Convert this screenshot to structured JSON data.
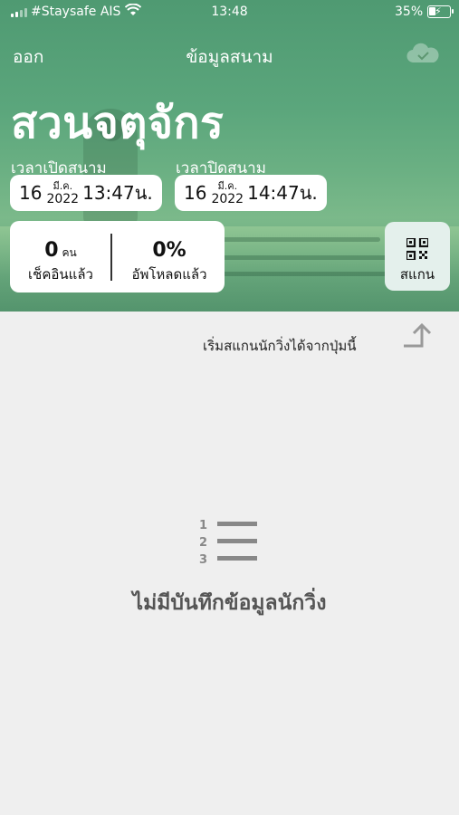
{
  "status_bar": {
    "carrier": "#Staysafe AIS",
    "time": "13:48",
    "battery_percent": "35%",
    "battery_level": 0.35
  },
  "nav": {
    "left_label": "ออก",
    "title": "ข้อมูลสนาม",
    "right_icon": "cloud-check-icon"
  },
  "field": {
    "name": "สวนจตุจักร"
  },
  "open_time": {
    "label": "เวลาเปิดสนาม",
    "day": "16",
    "month": "มี.ค.",
    "year": "2022",
    "time": "13:47น."
  },
  "close_time": {
    "label": "เวลาปิดสนาม",
    "day": "16",
    "month": "มี.ค.",
    "year": "2022",
    "time": "14:47น."
  },
  "stats": {
    "checked_in": {
      "value": "0",
      "unit": "คน",
      "label": "เช็คอินแล้ว"
    },
    "uploaded": {
      "value": "0%",
      "label": "อัพโหลดแล้ว"
    }
  },
  "scan_button": {
    "label": "สแกน",
    "icon": "qr-code-icon"
  },
  "hint": {
    "text": "เริ่มสแกนนักวิ่งได้จากปุ่มนี้",
    "icon": "arrow-up-icon"
  },
  "empty_state": {
    "icon": "numbered-list-icon",
    "message": "ไม่มีบันทึกข้อมูลนักวิ่ง"
  },
  "colors": {
    "hero_green": "#5ba67c",
    "scan_button_bg": "#e4f0ec",
    "page_bg": "#efefef"
  }
}
